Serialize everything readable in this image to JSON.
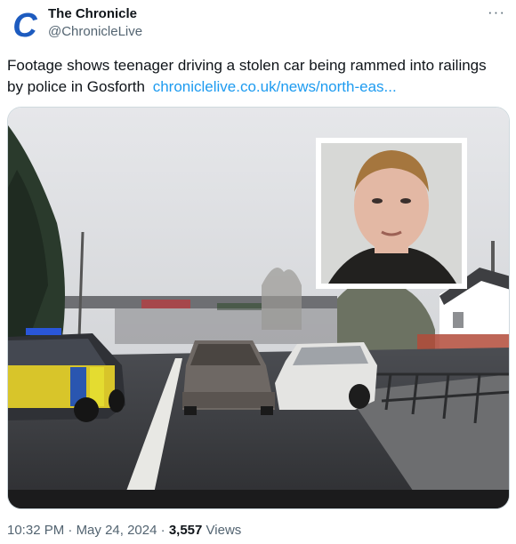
{
  "account": {
    "display_name": "The Chronicle",
    "handle": "@ChronicleLive",
    "avatar_letter": "C",
    "avatar_color": "#1d5bbf"
  },
  "menu": {
    "more_label": "···"
  },
  "tweet": {
    "text": "Footage shows teenager driving a stolen car being rammed into railings by police in Gosforth",
    "link_text": "chroniclelive.co.uk/news/north-eas..."
  },
  "media": {
    "type": "photo",
    "description_icon": "video-still-image"
  },
  "meta": {
    "time": "10:32 PM",
    "separator": "·",
    "date": "May 24, 2024",
    "views_count": "3,557",
    "views_label": "Views"
  },
  "colors": {
    "link": "#1d9bf0",
    "secondary_text": "#536471",
    "primary_text": "#0f1419"
  }
}
